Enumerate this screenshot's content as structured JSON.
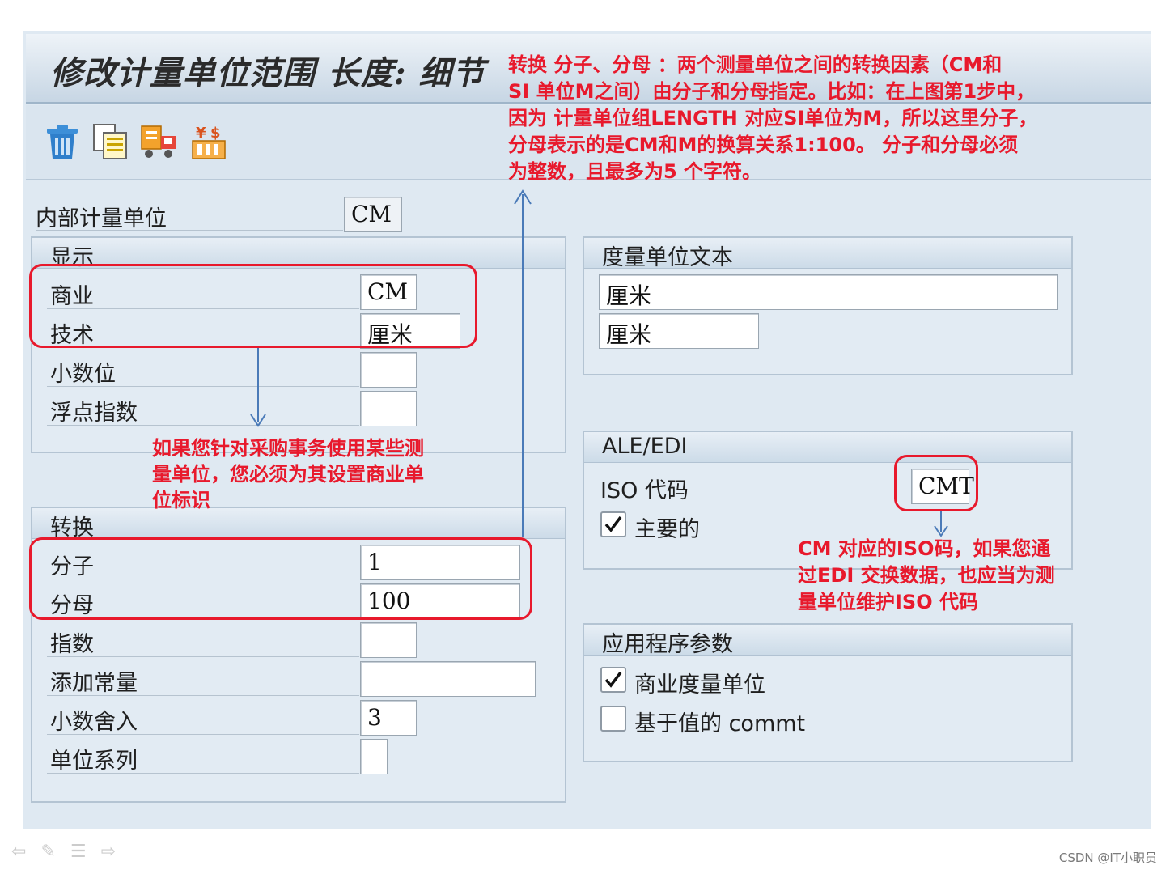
{
  "window": {
    "title": "修改计量单位范围 长度: 细节"
  },
  "toolbar": {
    "icons": [
      "trash-icon",
      "copy-icon",
      "truck-icon",
      "currency-table-icon"
    ]
  },
  "internal_uom": {
    "label": "内部计量单位",
    "value": "CM"
  },
  "display_group": {
    "title": "显示",
    "commercial": {
      "label": "商业",
      "value": "CM"
    },
    "technical": {
      "label": "技术",
      "value": "厘米"
    },
    "decimals": {
      "label": "小数位",
      "value": ""
    },
    "float_exp": {
      "label": "浮点指数",
      "value": ""
    }
  },
  "text_group": {
    "title": "度量单位文本",
    "long_text": "厘米",
    "short_text": "厘米"
  },
  "conversion_group": {
    "title": "转换",
    "numerator": {
      "label": "分子",
      "value": "1"
    },
    "denominator": {
      "label": "分母",
      "value": "100"
    },
    "exponent": {
      "label": "指数",
      "value": ""
    },
    "add_const": {
      "label": "添加常量",
      "value": ""
    },
    "rounding": {
      "label": "小数舍入",
      "value": "3"
    },
    "unit_family": {
      "label": "单位系列",
      "value": ""
    }
  },
  "ale_group": {
    "title": "ALE/EDI",
    "iso_code": {
      "label": "ISO 代码",
      "value": "CMT"
    },
    "primary": {
      "label": "主要的",
      "checked": true
    }
  },
  "app_group": {
    "title": "应用程序参数",
    "commercial_uom": {
      "label": "商业度量单位",
      "checked": true
    },
    "value_based": {
      "label": "基于值的 commt",
      "checked": false
    }
  },
  "annotations": {
    "conversion": [
      "转换 分子、分母 ：两个测量单位之间的转换因素（CM和",
      "SI 单位M之间）由分子和分母指定。比如：在上图第1步中，",
      "因为 计量单位组LENGTH 对应SI单位为M，所以这里分子，",
      "分母表示的是CM和M的换算关系1:100。 分子和分母必须",
      "为整数，且最多为5 个字符。"
    ],
    "commercial": [
      "如果您针对采购事务使用某些测",
      "量单位，您必须为其设置商业单",
      "位标识"
    ],
    "iso": [
      "CM 对应的ISO码，如果您通",
      "过EDI 交换数据，也应当为测",
      "量单位维护ISO 代码"
    ]
  },
  "footer": {
    "watermark": "CSDN @IT小职员"
  },
  "colors": {
    "annotation": "#e8192c",
    "arrow": "#4a7ab8"
  }
}
